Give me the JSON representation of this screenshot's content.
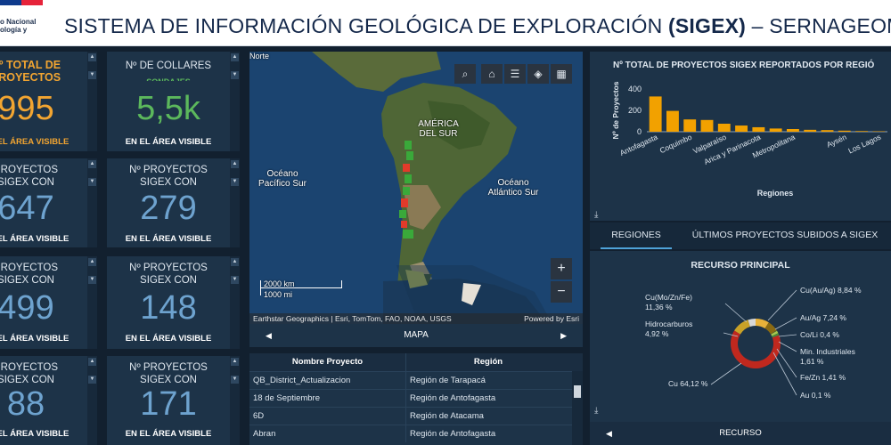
{
  "header": {
    "logo_text": "o Nacional ología y",
    "title_main": "SISTEMA DE INFORMACIÓN GEOLÓGICA DE EXPLORACIÓN ",
    "title_bold": "(SIGEX)",
    "title_tail": " – SERNAGEOMIN"
  },
  "colors": {
    "orange": "#f2a531",
    "green": "#5cb85c",
    "blue": "#6ea3cf",
    "bar": "#f2a100",
    "panel": "#1d3348"
  },
  "cards_left": [
    {
      "label": "Nº TOTAL DE PROYECTOS",
      "value": "995",
      "foot": "EN EL ÁREA VISIBLE",
      "color": "#f2a531"
    },
    {
      "label": "PROYECTOS SIGEX CON",
      "value": "647",
      "foot": "EN EL ÁREA VISIBLE",
      "color": "#6ea3cf"
    },
    {
      "label": "PROYECTOS SIGEX CON",
      "value": "499",
      "foot": "EN EL ÁREA VISIBLE",
      "color": "#6ea3cf"
    },
    {
      "label": "PROYECTOS SIGEX CON",
      "value": "88",
      "foot": "EN EL ÁREA VISIBLE",
      "color": "#6ea3cf"
    }
  ],
  "cards_right": [
    {
      "label": "Nº DE COLLARES",
      "sub": "SONDAJES",
      "value": "5,5k",
      "foot": "EN EL ÁREA VISIBLE",
      "color": "#5cb85c"
    },
    {
      "label": "Nº PROYECTOS SIGEX CON",
      "value": "279",
      "foot": "EN EL ÁREA VISIBLE",
      "color": "#6ea3cf"
    },
    {
      "label": "Nº PROYECTOS SIGEX CON",
      "value": "148",
      "foot": "EN EL ÁREA VISIBLE",
      "color": "#6ea3cf"
    },
    {
      "label": "Nº PROYECTOS SIGEX CON",
      "value": "171",
      "foot": "EN EL ÁREA VISIBLE",
      "color": "#6ea3cf"
    }
  ],
  "map": {
    "north": "Norte",
    "america": "AMÉRICA DEL SUR",
    "pacifico": "Océano Pacífico Sur",
    "atlantico": "Océano Atlántico Sur",
    "scale_km": "2000 km",
    "scale_mi": "1000 mi",
    "attribution": "Earthstar Geographics | Esri, TomTom, FAO, NOAA, USGS",
    "powered": "Powered by Esri",
    "tools": [
      "⌕",
      "⌂",
      "☰",
      "◈",
      "▦"
    ],
    "zoom_in": "+",
    "zoom_out": "−",
    "bar_label": "MAPA"
  },
  "table": {
    "headers": [
      "Nombre Proyecto",
      "Región"
    ],
    "rows": [
      [
        "QB_District_Actualizacion",
        "Región de Tarapacá"
      ],
      [
        "18 de Septiembre",
        "Región de Antofagasta"
      ],
      [
        "6D",
        "Región de Atacama"
      ],
      [
        "Abran",
        "Región de Antofagasta"
      ]
    ]
  },
  "tabs": [
    "REGIONES",
    "ÚLTIMOS PROYECTOS SUBIDOS A SIGEX"
  ],
  "chart_data": [
    {
      "type": "bar",
      "title": "Nº TOTAL DE PROYECTOS SIGEX REPORTADOS POR REGIÓ",
      "xlabel": "Regiones",
      "ylabel": "Nº de Proyectos",
      "ylim": [
        0,
        400
      ],
      "yticks": [
        0,
        200,
        400
      ],
      "categories": [
        "Antofagasta",
        "",
        "Coquimbo",
        "",
        "Valparaíso",
        "",
        "Arica y Parinacota",
        "",
        "Metropolitana",
        "",
        "",
        "Aysén",
        "",
        "Los Lagos"
      ],
      "values": [
        330,
        195,
        115,
        110,
        75,
        58,
        42,
        30,
        25,
        18,
        15,
        10,
        6,
        4
      ],
      "grid": false
    },
    {
      "type": "pie",
      "title": "RECURSO PRINCIPAL",
      "xlabel": "RECURSO",
      "categories": [
        "Cu",
        "Cu(Mo/Zn/Fe)",
        "Hidrocarburos",
        "Cu(Au/Ag)",
        "Au/Ag",
        "Co/Li",
        "Min. Industriales",
        "Fe/Zn",
        "Au"
      ],
      "labels": [
        "Cu 64,12 %",
        "Cu(Mo/Zn/Fe) 11,36 %",
        "Hidrocarburos 4,92 %",
        "Cu(Au/Ag) 8,84 %",
        "Au/Ag 7,24 %",
        "Co/Li 0,4 %",
        "Min. Industriales 1,61 %",
        "Fe/Zn 1,41 %",
        "Au 0,1 %"
      ],
      "values": [
        64.12,
        11.36,
        4.92,
        8.84,
        7.24,
        0.4,
        1.61,
        1.41,
        0.1
      ],
      "colors": [
        "#c0281e",
        "#c9a227",
        "#d8d8d8",
        "#e8b23a",
        "#8a6a12",
        "#5a6b2a",
        "#a9c94e",
        "#4a8a3a",
        "#777777"
      ]
    }
  ]
}
